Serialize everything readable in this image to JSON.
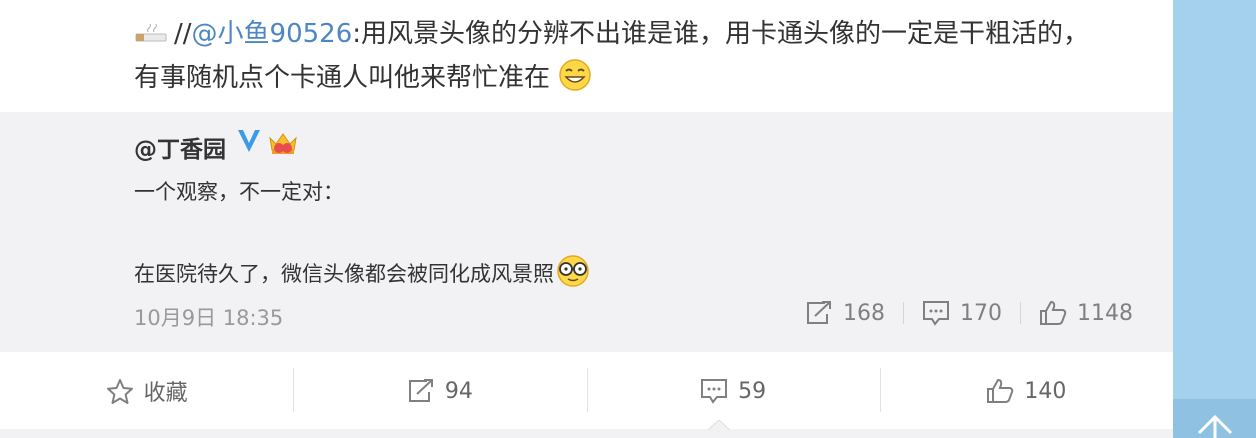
{
  "post": {
    "lead_sep": "//",
    "mention": "@小鱼90526",
    "text_line1": ":用风景头像的分辨不出谁是谁，用卡通头像的一定是干粗活的，",
    "text_line2": "有事随机点个卡通人叫他来帮忙准在"
  },
  "repost": {
    "author": "@丁香园",
    "body_line1": "一个观察，不一定对：",
    "body_line2": "",
    "body_line3": "在医院待久了，微信头像都会被同化成风景照",
    "time": "10月9日 18:35",
    "repost_count": "168",
    "comment_count": "170",
    "like_count": "1148"
  },
  "toolbar": {
    "favorite_label": "收藏",
    "repost_count": "94",
    "comment_count": "59",
    "like_count": "140"
  },
  "colors": {
    "mention": "#4d86c4",
    "verified": "#3d9ae8",
    "repost_bg": "#f2f2f5",
    "right_rail": "#a4d1ee"
  },
  "icons": [
    "cigarette-icon",
    "grin-emoji-icon",
    "verified-v-icon",
    "crown-member-icon",
    "glasses-emoji-icon",
    "repost-icon",
    "comment-icon",
    "like-icon",
    "star-icon",
    "back-to-top-icon"
  ]
}
